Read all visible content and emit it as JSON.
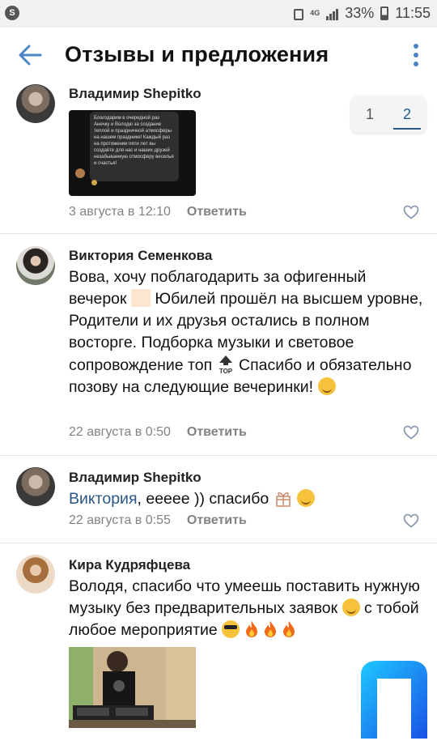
{
  "status": {
    "battery": "33%",
    "time": "11:55",
    "network": "4G"
  },
  "appbar": {
    "title": "Отзывы и предложения"
  },
  "pager": {
    "pages": [
      "1",
      "2"
    ],
    "active": "2"
  },
  "comments": [
    {
      "author": "Владимир Shepitko",
      "attachment_text": "Благодарим в очередной раз Анечку и Володю за создание теплой и праздничной атмосферы на нашем празднике! Каждый раз на протяжении пяти лет вы создаёте для нас и наших друзей незабываемую отмосферу веселья и счастья!",
      "date": "3 августа в 12:10",
      "reply": "Ответить"
    },
    {
      "author": "Виктория Семенкова",
      "text_1": "Вова, хочу поблагодарить за офигенный вечерок",
      "text_2": "Юбилей прошёл на высшем уровне, Родители и их друзья остались в полном восторге. Подборка музыки и световое сопровождение топ",
      "text_3": "Спасибо и обязательно позову на следующие вечеринки!",
      "top_badge": "TOP",
      "date": "22 августа в 0:50",
      "reply": "Ответить"
    },
    {
      "author": "Владимир Shepitko",
      "mention": "Виктория",
      "text": ", еееее )) спасибо",
      "date": "22 августа в 0:55",
      "reply": "Ответить"
    },
    {
      "author": "Кира Кудряфцева",
      "text_1": "Володя, спасибо что умеешь поставить нужную музыку без предварительных заявок",
      "text_2": "с тобой любое мероприятие"
    }
  ],
  "colors": {
    "accent": "#2a5885",
    "back_arrow": "#4a84c4",
    "meta": "#828282",
    "divider": "#e2e3e6"
  }
}
